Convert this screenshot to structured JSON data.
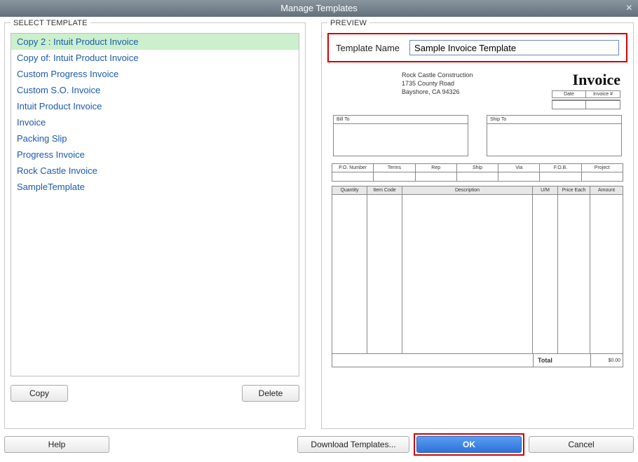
{
  "window": {
    "title": "Manage Templates"
  },
  "left": {
    "heading": "SELECT TEMPLATE",
    "items": [
      "Copy 2 : Intuit Product Invoice",
      "Copy of: Intuit Product Invoice",
      "Custom Progress Invoice",
      "Custom S.O. Invoice",
      "Intuit Product Invoice",
      "Invoice",
      "Packing Slip",
      "Progress Invoice",
      "Rock Castle Invoice",
      "SampleTemplate"
    ],
    "selected_index": 0,
    "copy_btn": "Copy",
    "delete_btn": "Delete"
  },
  "right": {
    "heading": "PREVIEW",
    "name_label": "Template Name",
    "name_value": "Sample Invoice Template"
  },
  "preview_invoice": {
    "company": "Rock Castle Construction",
    "addr1": "1735 County Road",
    "addr2": "Bayshore, CA 94326",
    "title": "Invoice",
    "date_label": "Date",
    "invnum_label": "Invoice #",
    "billto": "Bill To",
    "shipto": "Ship To",
    "meta": [
      "P.O. Number",
      "Terms",
      "Rep",
      "Ship",
      "Via",
      "F.O.B.",
      "Project"
    ],
    "cols": [
      "Quantity",
      "Item Code",
      "Description",
      "U/M",
      "Price Each",
      "Amount"
    ],
    "total_label": "Total",
    "total_value": "$0.00"
  },
  "footer": {
    "help": "Help",
    "download": "Download Templates...",
    "ok": "OK",
    "cancel": "Cancel"
  }
}
